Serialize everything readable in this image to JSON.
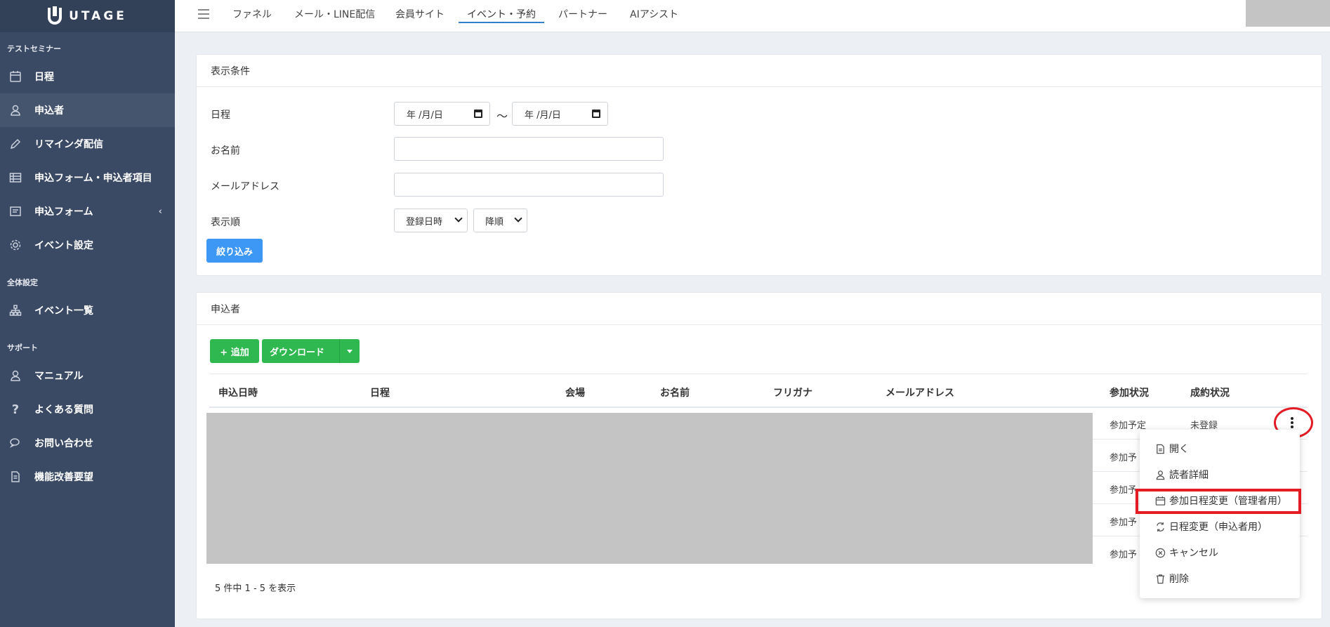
{
  "brand": {
    "logo_text": "UTAGE"
  },
  "sidebar": {
    "sections": [
      {
        "title": "テストセミナー"
      },
      {
        "title": "全体設定"
      },
      {
        "title": "サポート"
      }
    ],
    "items": [
      {
        "label": "日程",
        "icon": "calendar-icon"
      },
      {
        "label": "申込者",
        "icon": "user-icon",
        "active": true
      },
      {
        "label": "リマインダ配信",
        "icon": "pencil-icon"
      },
      {
        "label": "申込フォーム・申込者項目",
        "icon": "table-icon"
      },
      {
        "label": "申込フォーム",
        "icon": "form-icon",
        "arrow": "‹"
      },
      {
        "label": "イベント設定",
        "icon": "gear-icon"
      },
      {
        "label": "イベント一覧",
        "icon": "sitemap-icon"
      },
      {
        "label": "マニュアル",
        "icon": "user-icon"
      },
      {
        "label": "よくある質問",
        "icon": "question-icon"
      },
      {
        "label": "お問い合わせ",
        "icon": "chat-icon"
      },
      {
        "label": "機能改善要望",
        "icon": "document-icon"
      }
    ]
  },
  "topnav": {
    "items": [
      "ファネル",
      "メール・LINE配信",
      "会員サイト",
      "イベント・予約",
      "パートナー",
      "AIアシスト"
    ],
    "active_index": 3
  },
  "filter": {
    "title": "表示条件",
    "date_label": "日程",
    "date_from_placeholder": "年 /月/日",
    "date_to_placeholder": "年 /月/日",
    "tilde": "〜",
    "name_label": "お名前",
    "email_label": "メールアドレス",
    "order_label": "表示順",
    "order_field": "登録日時",
    "order_direction": "降順",
    "submit_label": "絞り込み"
  },
  "applicants": {
    "title": "申込者",
    "add_label": "+ 追加",
    "download_label": "ダウンロード",
    "columns": [
      "申込日時",
      "日程",
      "会場",
      "お名前",
      "フリガナ",
      "メールアドレス",
      "参加状況",
      "成約状況"
    ],
    "rows": [
      {
        "status": "参加予定",
        "contract": "未登録"
      },
      {
        "status": "参加予"
      },
      {
        "status": "参加予"
      },
      {
        "status": "参加予"
      },
      {
        "status": "参加予"
      }
    ],
    "pagination_text": "5 件中 1 - 5 を表示"
  },
  "row_menu": {
    "items": [
      {
        "label": "開く",
        "icon": "file-icon"
      },
      {
        "label": "読者詳細",
        "icon": "user-icon"
      },
      {
        "label": "参加日程変更（管理者用）",
        "icon": "calendar-icon",
        "highlighted": true
      },
      {
        "label": "日程変更（申込者用）",
        "icon": "exchange-icon"
      },
      {
        "label": "キャンセル",
        "icon": "cancel-circle-icon"
      },
      {
        "label": "削除",
        "icon": "trash-icon"
      }
    ]
  },
  "colors": {
    "sidebar_bg": "#3b4a64",
    "primary_blue": "#3d98f5",
    "green": "#2fb84f",
    "highlight_red": "#e21b25"
  }
}
